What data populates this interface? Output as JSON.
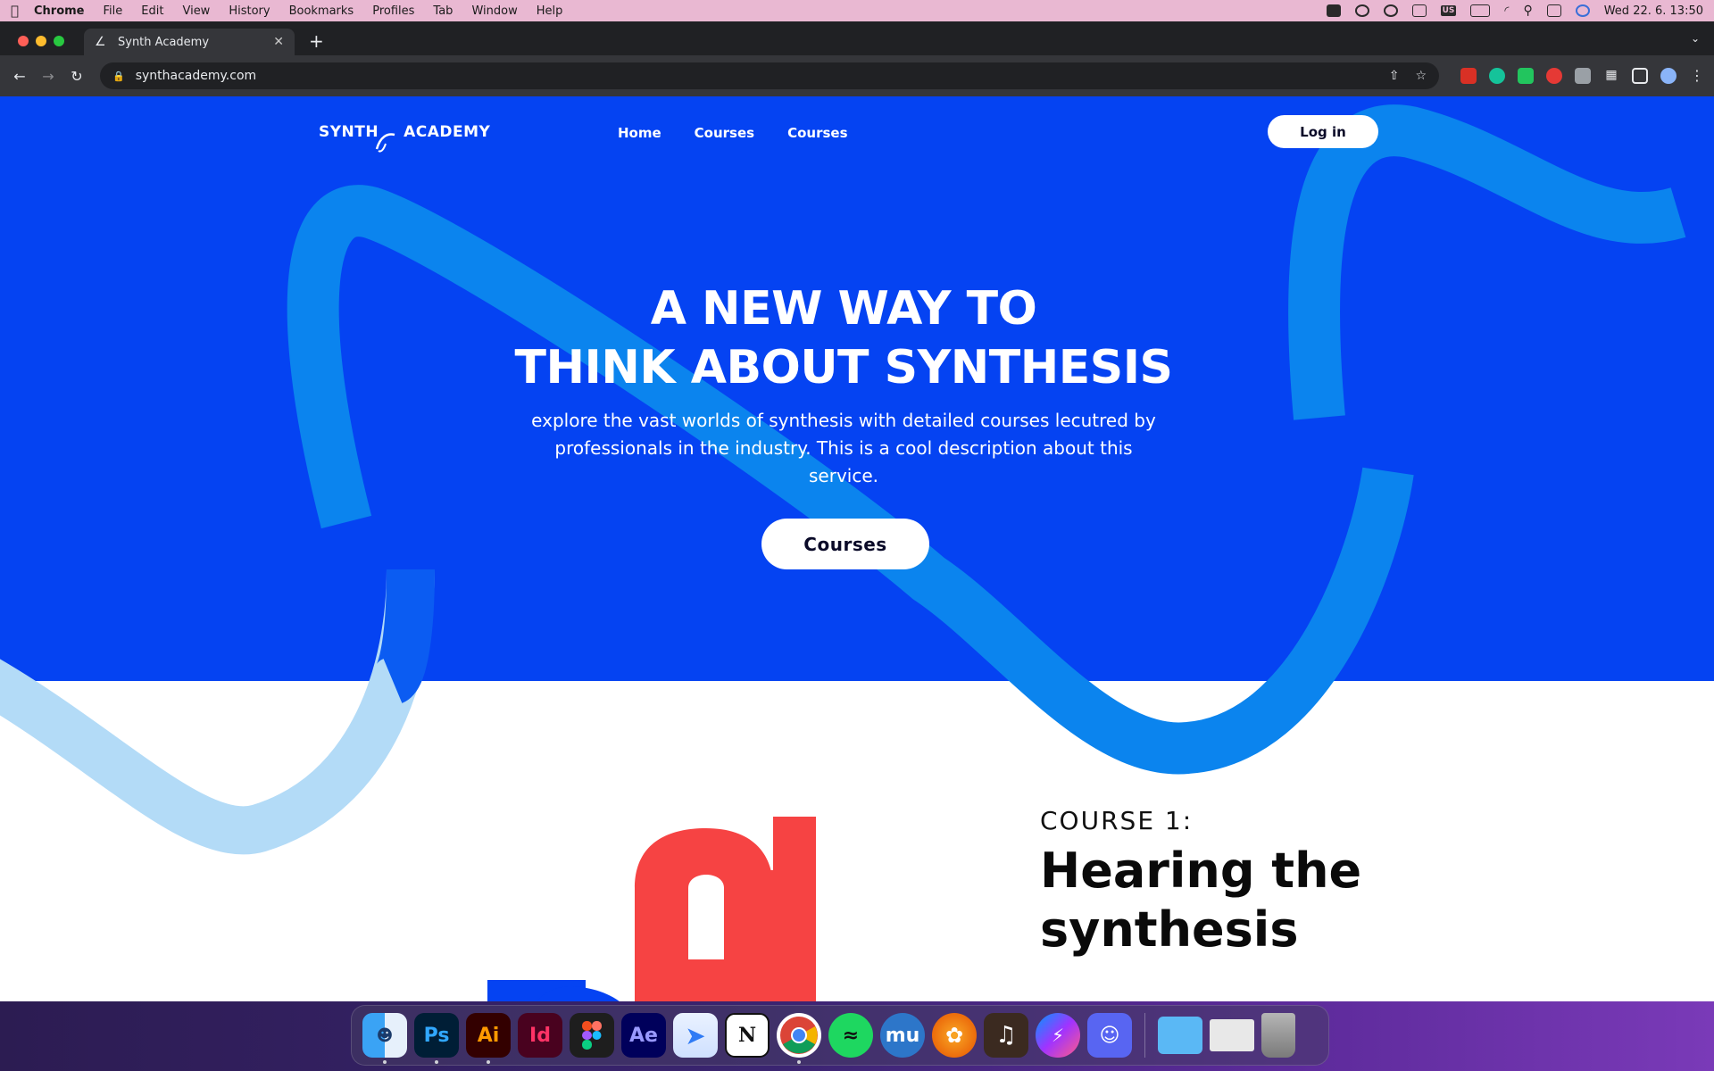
{
  "menubar": {
    "app_name": "Chrome",
    "menus": [
      "File",
      "Edit",
      "View",
      "History",
      "Bookmarks",
      "Profiles",
      "Tab",
      "Window",
      "Help"
    ],
    "clock": "Wed 22. 6.  13:50",
    "input_source": "US"
  },
  "browser": {
    "tab_title": "Synth Academy",
    "url": "synthacademy.com"
  },
  "site": {
    "logo_part1": "SYNTH",
    "logo_part2": "ACADEMY",
    "nav": [
      "Home",
      "Courses",
      "Courses"
    ],
    "login_label": "Log in",
    "hero_title_line1": "A NEW WAY TO",
    "hero_title_line2": "THINK ABOUT SYNTHESIS",
    "hero_description": "explore the vast worlds of synthesis with detailed courses lecutred by professionals in the industry. This is a cool description about this service.",
    "cta_label": "Courses",
    "course_kicker": "COURSE 1:",
    "course_title_line1": "Hearing the",
    "course_title_line2": "synthesis"
  },
  "dock": {
    "apps": [
      {
        "name": "Finder",
        "label": "",
        "color": "#3aa3f5",
        "running": true
      },
      {
        "name": "Photoshop",
        "label": "Ps",
        "color": "#001e36",
        "text": "#31a8ff",
        "running": true
      },
      {
        "name": "Illustrator",
        "label": "Ai",
        "color": "#330000",
        "text": "#ff9a00",
        "running": true
      },
      {
        "name": "InDesign",
        "label": "Id",
        "color": "#49021f",
        "text": "#ff3366",
        "running": false
      },
      {
        "name": "Figma",
        "label": "",
        "color": "#1e1e1e",
        "running": false
      },
      {
        "name": "After Effects",
        "label": "Ae",
        "color": "#00005b",
        "text": "#9999ff",
        "running": false
      },
      {
        "name": "Spark",
        "label": "",
        "color": "#2f7bf5",
        "running": false
      },
      {
        "name": "Notion",
        "label": "N",
        "color": "#ffffff",
        "text": "#111111",
        "running": false
      },
      {
        "name": "Chrome",
        "label": "",
        "color": "#ffffff",
        "running": true
      },
      {
        "name": "Spotify",
        "label": "",
        "color": "#1ed760",
        "running": false
      },
      {
        "name": "MuseScore",
        "label": "mu",
        "color": "#2d76c9",
        "text": "#ffffff",
        "running": false
      },
      {
        "name": "FL Studio",
        "label": "",
        "color": "#f57c00",
        "running": false
      },
      {
        "name": "GarageBand",
        "label": "",
        "color": "#3b2a20",
        "running": false
      },
      {
        "name": "Messenger",
        "label": "",
        "color": "#a033ff",
        "running": false
      },
      {
        "name": "Discord",
        "label": "",
        "color": "#5865f2",
        "running": false
      }
    ],
    "others": [
      {
        "name": "Downloads folder",
        "color": "#5ab8f5"
      },
      {
        "name": "Recent document",
        "color": "#e8e8e8"
      },
      {
        "name": "Trash",
        "color": "#9a9a9a"
      }
    ]
  },
  "colors": {
    "hero_blue": "#0543f2",
    "wave_blue": "#0b84ee",
    "wave_light": "#b3dbf7",
    "course_red": "#f64343",
    "course_yellow": "#f7b641",
    "course_blue": "#0543f2"
  }
}
